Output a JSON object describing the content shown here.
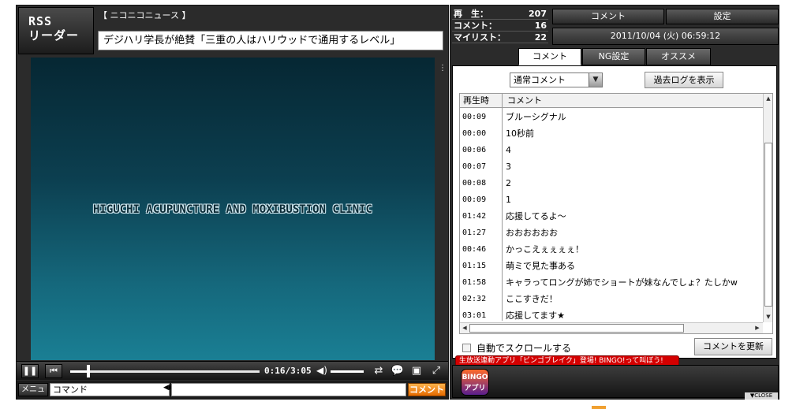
{
  "logo": {
    "line1": "RSS",
    "line2": "リーダー"
  },
  "feed": {
    "source": "【 ニコニコニュース 】",
    "headline": "デジハリ学長が絶賛「三重の人はハリウッドで通用するレベル」"
  },
  "video": {
    "overlay_text": "HIGUCHI ACUPUNCTURE AND MOXIBUSTION CLINIC"
  },
  "controls": {
    "time": "0:16/3:05",
    "progress_fraction": 0.086,
    "menu_label": "メニュー",
    "command_placeholder": "コマンド",
    "comment_send_label": "コメント"
  },
  "stats": {
    "play_label": "再　生：",
    "play_value": "207",
    "comment_label": "コメント：",
    "comment_value": "16",
    "mylist_label": "マイリスト：",
    "mylist_value": "22"
  },
  "top_tabs": {
    "comment": "コメント",
    "settings": "設定"
  },
  "datetime": "2011/10/04 (火) 06:59:12",
  "sub_tabs": {
    "comment": "コメント",
    "ng": "NG設定",
    "recommend": "オススメ"
  },
  "comment_panel": {
    "filter_selected": "通常コメント",
    "past_log_button": "過去ログを表示",
    "headers": {
      "time": "再生時",
      "comment": "コメント"
    },
    "rows": [
      {
        "time": "00:09",
        "text": "ブルーシグナル"
      },
      {
        "time": "00:00",
        "text": "10秒前"
      },
      {
        "time": "00:06",
        "text": "4"
      },
      {
        "time": "00:07",
        "text": "3"
      },
      {
        "time": "00:08",
        "text": "2"
      },
      {
        "time": "00:09",
        "text": "1"
      },
      {
        "time": "01:42",
        "text": "応援してるよ～"
      },
      {
        "time": "01:27",
        "text": "おおおおおお"
      },
      {
        "time": "00:46",
        "text": "かっこえぇぇぇぇ！"
      },
      {
        "time": "01:15",
        "text": "萌ミで見た事ある"
      },
      {
        "time": "01:58",
        "text": "キャラってロングが姉でショートが妹なんでしょ？たしかw"
      },
      {
        "time": "02:32",
        "text": "ここすきだ！"
      },
      {
        "time": "03:01",
        "text": "応援してます★"
      }
    ],
    "autoscroll_label": "自動でスクロールする",
    "refresh_button": "コメントを更新"
  },
  "ad": {
    "banner": "生放送連動アプリ「ビンゴブレイク」登場! BINGO!って叫ぼう!",
    "icon_line1": "BINGO",
    "icon_line2": "アプリ",
    "close_label": "▼CLOSE"
  }
}
